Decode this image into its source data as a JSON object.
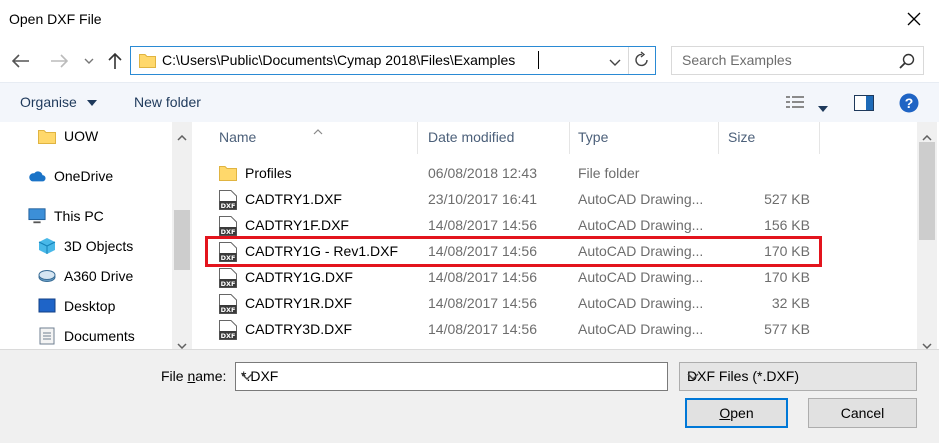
{
  "window": {
    "title": "Open DXF File",
    "close_icon": "close-icon"
  },
  "nav": {
    "back_icon": "back-arrow-icon",
    "forward_icon": "forward-arrow-icon",
    "recent_icon": "chevron-down-icon",
    "up_icon": "up-arrow-icon"
  },
  "address": {
    "path": "C:\\Users\\Public\\Documents\\Cymap 2018\\Files\\Examples"
  },
  "search": {
    "placeholder": "Search Examples"
  },
  "toolbar": {
    "organise_label": "Organise",
    "new_folder_label": "New folder"
  },
  "sidebar": {
    "items": [
      {
        "label": "UOW",
        "icon": "folder-icon"
      },
      {
        "label": "OneDrive",
        "icon": "cloud-icon"
      },
      {
        "label": "This PC",
        "icon": "computer-icon"
      },
      {
        "label": "3D Objects",
        "icon": "cube-icon"
      },
      {
        "label": "A360 Drive",
        "icon": "drive-icon"
      },
      {
        "label": "Desktop",
        "icon": "desktop-icon"
      },
      {
        "label": "Documents",
        "icon": "document-icon"
      }
    ]
  },
  "columns": {
    "name": "Name",
    "date": "Date modified",
    "type": "Type",
    "size": "Size"
  },
  "files": [
    {
      "name": "Profiles",
      "date": "06/08/2018 12:43",
      "type": "File folder",
      "size": "",
      "icon": "folder-icon"
    },
    {
      "name": "CADTRY1.DXF",
      "date": "23/10/2017 16:41",
      "type": "AutoCAD Drawing...",
      "size": "527 KB",
      "icon": "dxf-file-icon"
    },
    {
      "name": "CADTRY1F.DXF",
      "date": "14/08/2017 14:56",
      "type": "AutoCAD Drawing...",
      "size": "156 KB",
      "icon": "dxf-file-icon"
    },
    {
      "name": "CADTRY1G - Rev1.DXF",
      "date": "14/08/2017 14:56",
      "type": "AutoCAD Drawing...",
      "size": "170 KB",
      "icon": "dxf-file-icon",
      "highlighted": true
    },
    {
      "name": "CADTRY1G.DXF",
      "date": "14/08/2017 14:56",
      "type": "AutoCAD Drawing...",
      "size": "170 KB",
      "icon": "dxf-file-icon"
    },
    {
      "name": "CADTRY1R.DXF",
      "date": "14/08/2017 14:56",
      "type": "AutoCAD Drawing...",
      "size": "32 KB",
      "icon": "dxf-file-icon"
    },
    {
      "name": "CADTRY3D.DXF",
      "date": "14/08/2017 14:56",
      "type": "AutoCAD Drawing...",
      "size": "577 KB",
      "icon": "dxf-file-icon"
    }
  ],
  "footer": {
    "file_name_label_prefix": "File ",
    "file_name_label_accel": "n",
    "file_name_label_suffix": "ame:",
    "file_name_value": "*.DXF",
    "file_type_value": "DXF Files (*.DXF)",
    "open_accel": "O",
    "open_rest": "pen",
    "cancel_label": "Cancel"
  },
  "colors": {
    "highlight_border": "#e3141d",
    "accent": "#0078d7",
    "folder": "#ffd86b"
  }
}
